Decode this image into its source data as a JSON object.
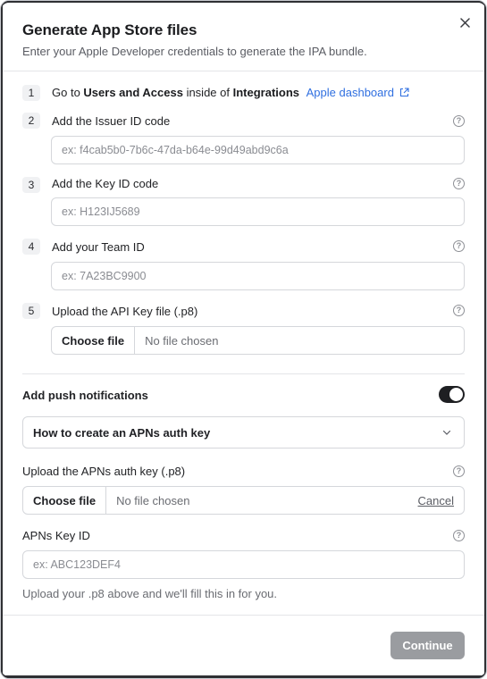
{
  "dialog": {
    "title": "Generate App Store files",
    "subtitle": "Enter your Apple Developer credentials to generate the IPA bundle.",
    "close_icon": "close-icon"
  },
  "steps": [
    {
      "number": "1",
      "text_prefix": "Go to ",
      "strong1": "Users and Access",
      "text_mid": " inside of ",
      "strong2": "Integrations",
      "link_label": "Apple dashboard",
      "link_icon": "external-link-icon"
    },
    {
      "number": "2",
      "label": "Add the Issuer ID code",
      "placeholder": "ex: f4cab5b0-7b6c-47da-b64e-99d49abd9c6a",
      "help_icon": "help-circle-icon"
    },
    {
      "number": "3",
      "label": "Add the Key ID code",
      "placeholder": "ex: H123IJ5689",
      "help_icon": "help-circle-icon"
    },
    {
      "number": "4",
      "label": "Add your Team ID",
      "placeholder": "ex: 7A23BC9900",
      "help_icon": "help-circle-icon"
    },
    {
      "number": "5",
      "label": "Upload the API Key file (.p8)",
      "button_label": "Choose file",
      "status": "No file chosen",
      "help_icon": "help-circle-icon"
    }
  ],
  "push": {
    "label": "Add push notifications",
    "enabled": true,
    "accordion_label": "How to create an APNs auth key",
    "upload_label": "Upload the APNs auth key (.p8)",
    "upload_button": "Choose file",
    "upload_status": "No file chosen",
    "cancel_label": "Cancel",
    "key_id_label": "APNs Key ID",
    "key_id_placeholder": "ex: ABC123DEF4",
    "hint": "Upload your .p8 above and we'll fill this in for you."
  },
  "footer": {
    "continue_label": "Continue"
  },
  "colors": {
    "link": "#2f6fe0",
    "toggle_on": "#1e1f22",
    "continue_disabled": "#9a9ca0"
  }
}
